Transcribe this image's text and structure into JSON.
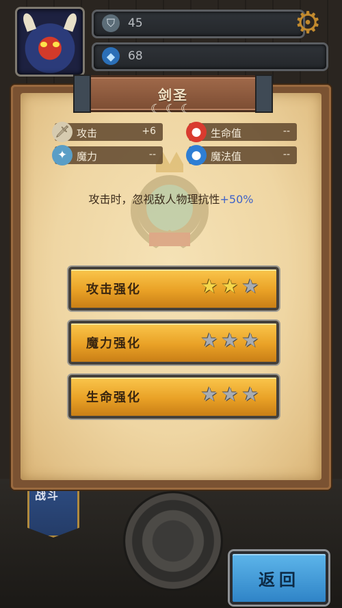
{
  "hud": {
    "stat1_value": "45",
    "stat2_value": "68",
    "stat1_icon": "armor-icon",
    "stat2_icon": "gem-icon",
    "settings_icon": "gear-icon"
  },
  "panel": {
    "title": "剑圣",
    "stats": [
      {
        "label": "攻击",
        "value": "+6",
        "icon": "sword-icon"
      },
      {
        "label": "生命值",
        "value": "--",
        "icon": "health-potion-icon"
      },
      {
        "label": "魔力",
        "value": "--",
        "icon": "magic-staff-icon"
      },
      {
        "label": "魔法值",
        "value": "--",
        "icon": "mana-potion-icon"
      }
    ],
    "description": "攻击时，忽视敌人物理抗性",
    "description_highlight": "+50%"
  },
  "upgrades": [
    {
      "label": "攻击强化",
      "stars_filled": 2,
      "stars_total": 3
    },
    {
      "label": "魔力强化",
      "stars_filled": 0,
      "stars_total": 3
    },
    {
      "label": "生命强化",
      "stars_filled": 0,
      "stars_total": 3
    }
  ],
  "background": {
    "banner_text": "战斗"
  },
  "back_label": "返回",
  "colors": {
    "button_gold": "#e9a126",
    "back_blue": "#3f96d6",
    "highlight_blue": "#3f63c8",
    "star_on": "#f5d64a",
    "star_off": "#a8acb2"
  }
}
